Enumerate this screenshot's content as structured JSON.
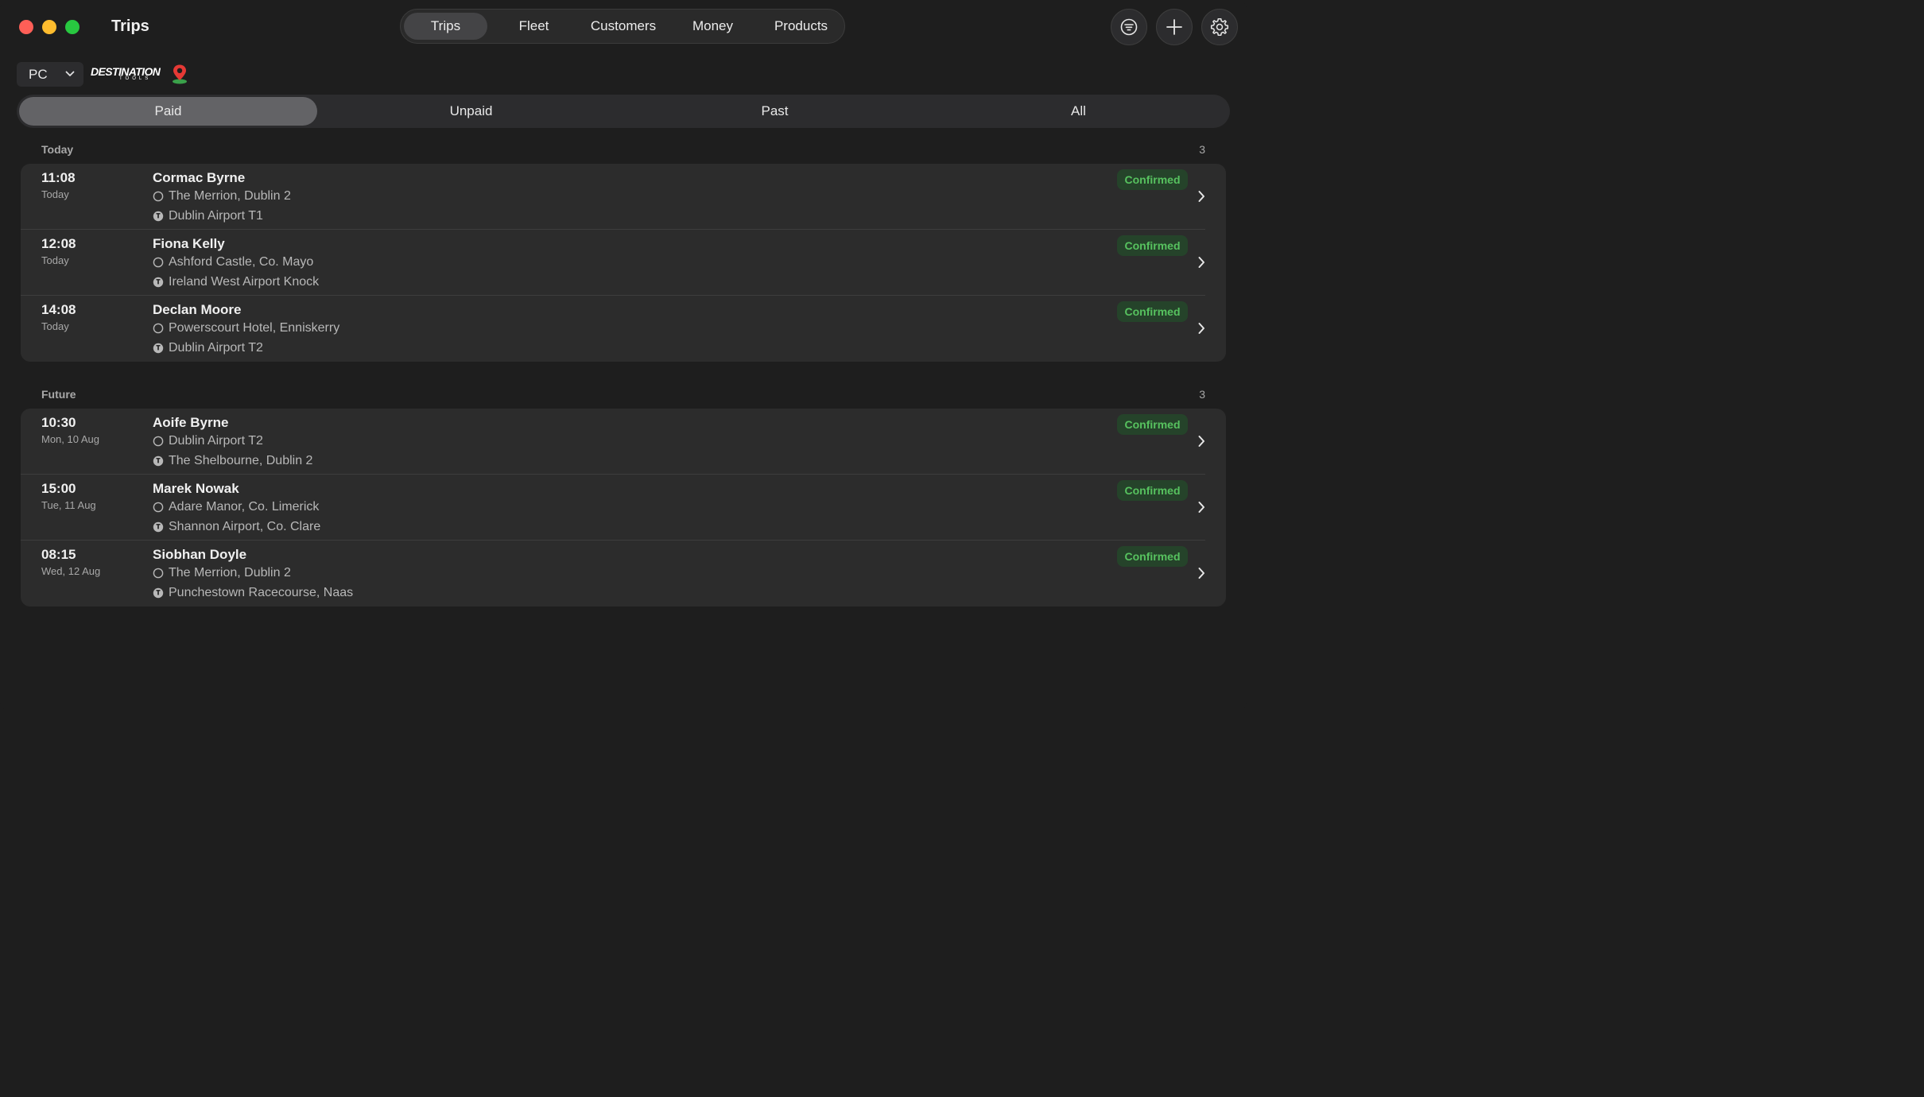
{
  "window": {
    "title": "Trips",
    "colors": {
      "close": "#ff5f57",
      "minimize": "#febc2e",
      "maximize": "#28c840"
    }
  },
  "nav": {
    "items": [
      {
        "label": "Trips",
        "active": true
      },
      {
        "label": "Fleet",
        "active": false
      },
      {
        "label": "Customers",
        "active": false
      },
      {
        "label": "Money",
        "active": false
      },
      {
        "label": "Products",
        "active": false
      }
    ]
  },
  "actions": {
    "filter_icon": "filter-icon",
    "add_icon": "plus-icon",
    "settings_icon": "gear-icon"
  },
  "toolbar": {
    "picker_value": "PC",
    "logo": {
      "main": "DESTINATION",
      "sub": "TOOLS"
    }
  },
  "filters": {
    "items": [
      {
        "label": "Paid",
        "active": true
      },
      {
        "label": "Unpaid",
        "active": false
      },
      {
        "label": "Past",
        "active": false
      },
      {
        "label": "All",
        "active": false
      }
    ]
  },
  "status_color": "#57c25f",
  "sections": [
    {
      "title": "Today",
      "count": "3",
      "trips": [
        {
          "time": "11:08",
          "date": "Today",
          "name": "Cormac Byrne",
          "from": "The Merrion, Dublin 2",
          "to": "Dublin Airport T1",
          "status": "Confirmed"
        },
        {
          "time": "12:08",
          "date": "Today",
          "name": "Fiona Kelly",
          "from": "Ashford Castle, Co. Mayo",
          "to": "Ireland West Airport Knock",
          "status": "Confirmed"
        },
        {
          "time": "14:08",
          "date": "Today",
          "name": "Declan Moore",
          "from": "Powerscourt Hotel, Enniskerry",
          "to": "Dublin Airport T2",
          "status": "Confirmed"
        }
      ]
    },
    {
      "title": "Future",
      "count": "3",
      "trips": [
        {
          "time": "10:30",
          "date": "Mon, 10 Aug",
          "name": "Aoife Byrne",
          "from": "Dublin Airport T2",
          "to": "The Shelbourne, Dublin 2",
          "status": "Confirmed"
        },
        {
          "time": "15:00",
          "date": "Tue, 11 Aug",
          "name": "Marek Nowak",
          "from": "Adare Manor, Co. Limerick",
          "to": "Shannon Airport, Co. Clare",
          "status": "Confirmed"
        },
        {
          "time": "08:15",
          "date": "Wed, 12 Aug",
          "name": "Siobhan Doyle",
          "from": "The Merrion, Dublin 2",
          "to": "Punchestown Racecourse, Naas",
          "status": "Confirmed"
        }
      ]
    }
  ]
}
